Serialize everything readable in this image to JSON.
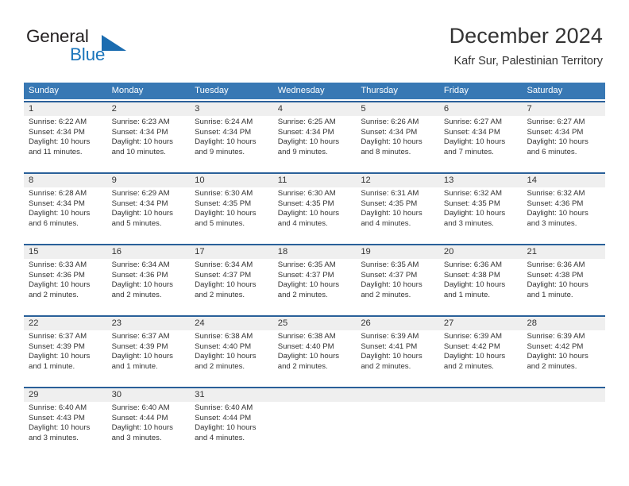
{
  "brand": {
    "name_part1": "General",
    "name_part2": "Blue",
    "triangle_icon": "triangle-icon",
    "accent_color": "#1b75bb"
  },
  "header": {
    "title": "December 2024",
    "subtitle": "Kafr Sur, Palestinian Territory"
  },
  "colors": {
    "header_row_bg": "#3878b4",
    "week_separator": "#2a6099",
    "daynum_bg": "#efefef",
    "text": "#333333"
  },
  "weekdays": [
    "Sunday",
    "Monday",
    "Tuesday",
    "Wednesday",
    "Thursday",
    "Friday",
    "Saturday"
  ],
  "weeks": [
    {
      "days": [
        {
          "num": "1",
          "sunrise": "Sunrise: 6:22 AM",
          "sunset": "Sunset: 4:34 PM",
          "daylight1": "Daylight: 10 hours",
          "daylight2": "and 11 minutes."
        },
        {
          "num": "2",
          "sunrise": "Sunrise: 6:23 AM",
          "sunset": "Sunset: 4:34 PM",
          "daylight1": "Daylight: 10 hours",
          "daylight2": "and 10 minutes."
        },
        {
          "num": "3",
          "sunrise": "Sunrise: 6:24 AM",
          "sunset": "Sunset: 4:34 PM",
          "daylight1": "Daylight: 10 hours",
          "daylight2": "and 9 minutes."
        },
        {
          "num": "4",
          "sunrise": "Sunrise: 6:25 AM",
          "sunset": "Sunset: 4:34 PM",
          "daylight1": "Daylight: 10 hours",
          "daylight2": "and 9 minutes."
        },
        {
          "num": "5",
          "sunrise": "Sunrise: 6:26 AM",
          "sunset": "Sunset: 4:34 PM",
          "daylight1": "Daylight: 10 hours",
          "daylight2": "and 8 minutes."
        },
        {
          "num": "6",
          "sunrise": "Sunrise: 6:27 AM",
          "sunset": "Sunset: 4:34 PM",
          "daylight1": "Daylight: 10 hours",
          "daylight2": "and 7 minutes."
        },
        {
          "num": "7",
          "sunrise": "Sunrise: 6:27 AM",
          "sunset": "Sunset: 4:34 PM",
          "daylight1": "Daylight: 10 hours",
          "daylight2": "and 6 minutes."
        }
      ]
    },
    {
      "days": [
        {
          "num": "8",
          "sunrise": "Sunrise: 6:28 AM",
          "sunset": "Sunset: 4:34 PM",
          "daylight1": "Daylight: 10 hours",
          "daylight2": "and 6 minutes."
        },
        {
          "num": "9",
          "sunrise": "Sunrise: 6:29 AM",
          "sunset": "Sunset: 4:34 PM",
          "daylight1": "Daylight: 10 hours",
          "daylight2": "and 5 minutes."
        },
        {
          "num": "10",
          "sunrise": "Sunrise: 6:30 AM",
          "sunset": "Sunset: 4:35 PM",
          "daylight1": "Daylight: 10 hours",
          "daylight2": "and 5 minutes."
        },
        {
          "num": "11",
          "sunrise": "Sunrise: 6:30 AM",
          "sunset": "Sunset: 4:35 PM",
          "daylight1": "Daylight: 10 hours",
          "daylight2": "and 4 minutes."
        },
        {
          "num": "12",
          "sunrise": "Sunrise: 6:31 AM",
          "sunset": "Sunset: 4:35 PM",
          "daylight1": "Daylight: 10 hours",
          "daylight2": "and 4 minutes."
        },
        {
          "num": "13",
          "sunrise": "Sunrise: 6:32 AM",
          "sunset": "Sunset: 4:35 PM",
          "daylight1": "Daylight: 10 hours",
          "daylight2": "and 3 minutes."
        },
        {
          "num": "14",
          "sunrise": "Sunrise: 6:32 AM",
          "sunset": "Sunset: 4:36 PM",
          "daylight1": "Daylight: 10 hours",
          "daylight2": "and 3 minutes."
        }
      ]
    },
    {
      "days": [
        {
          "num": "15",
          "sunrise": "Sunrise: 6:33 AM",
          "sunset": "Sunset: 4:36 PM",
          "daylight1": "Daylight: 10 hours",
          "daylight2": "and 2 minutes."
        },
        {
          "num": "16",
          "sunrise": "Sunrise: 6:34 AM",
          "sunset": "Sunset: 4:36 PM",
          "daylight1": "Daylight: 10 hours",
          "daylight2": "and 2 minutes."
        },
        {
          "num": "17",
          "sunrise": "Sunrise: 6:34 AM",
          "sunset": "Sunset: 4:37 PM",
          "daylight1": "Daylight: 10 hours",
          "daylight2": "and 2 minutes."
        },
        {
          "num": "18",
          "sunrise": "Sunrise: 6:35 AM",
          "sunset": "Sunset: 4:37 PM",
          "daylight1": "Daylight: 10 hours",
          "daylight2": "and 2 minutes."
        },
        {
          "num": "19",
          "sunrise": "Sunrise: 6:35 AM",
          "sunset": "Sunset: 4:37 PM",
          "daylight1": "Daylight: 10 hours",
          "daylight2": "and 2 minutes."
        },
        {
          "num": "20",
          "sunrise": "Sunrise: 6:36 AM",
          "sunset": "Sunset: 4:38 PM",
          "daylight1": "Daylight: 10 hours",
          "daylight2": "and 1 minute."
        },
        {
          "num": "21",
          "sunrise": "Sunrise: 6:36 AM",
          "sunset": "Sunset: 4:38 PM",
          "daylight1": "Daylight: 10 hours",
          "daylight2": "and 1 minute."
        }
      ]
    },
    {
      "days": [
        {
          "num": "22",
          "sunrise": "Sunrise: 6:37 AM",
          "sunset": "Sunset: 4:39 PM",
          "daylight1": "Daylight: 10 hours",
          "daylight2": "and 1 minute."
        },
        {
          "num": "23",
          "sunrise": "Sunrise: 6:37 AM",
          "sunset": "Sunset: 4:39 PM",
          "daylight1": "Daylight: 10 hours",
          "daylight2": "and 1 minute."
        },
        {
          "num": "24",
          "sunrise": "Sunrise: 6:38 AM",
          "sunset": "Sunset: 4:40 PM",
          "daylight1": "Daylight: 10 hours",
          "daylight2": "and 2 minutes."
        },
        {
          "num": "25",
          "sunrise": "Sunrise: 6:38 AM",
          "sunset": "Sunset: 4:40 PM",
          "daylight1": "Daylight: 10 hours",
          "daylight2": "and 2 minutes."
        },
        {
          "num": "26",
          "sunrise": "Sunrise: 6:39 AM",
          "sunset": "Sunset: 4:41 PM",
          "daylight1": "Daylight: 10 hours",
          "daylight2": "and 2 minutes."
        },
        {
          "num": "27",
          "sunrise": "Sunrise: 6:39 AM",
          "sunset": "Sunset: 4:42 PM",
          "daylight1": "Daylight: 10 hours",
          "daylight2": "and 2 minutes."
        },
        {
          "num": "28",
          "sunrise": "Sunrise: 6:39 AM",
          "sunset": "Sunset: 4:42 PM",
          "daylight1": "Daylight: 10 hours",
          "daylight2": "and 2 minutes."
        }
      ]
    },
    {
      "days": [
        {
          "num": "29",
          "sunrise": "Sunrise: 6:40 AM",
          "sunset": "Sunset: 4:43 PM",
          "daylight1": "Daylight: 10 hours",
          "daylight2": "and 3 minutes."
        },
        {
          "num": "30",
          "sunrise": "Sunrise: 6:40 AM",
          "sunset": "Sunset: 4:44 PM",
          "daylight1": "Daylight: 10 hours",
          "daylight2": "and 3 minutes."
        },
        {
          "num": "31",
          "sunrise": "Sunrise: 6:40 AM",
          "sunset": "Sunset: 4:44 PM",
          "daylight1": "Daylight: 10 hours",
          "daylight2": "and 4 minutes."
        },
        {
          "num": "",
          "sunrise": "",
          "sunset": "",
          "daylight1": "",
          "daylight2": ""
        },
        {
          "num": "",
          "sunrise": "",
          "sunset": "",
          "daylight1": "",
          "daylight2": ""
        },
        {
          "num": "",
          "sunrise": "",
          "sunset": "",
          "daylight1": "",
          "daylight2": ""
        },
        {
          "num": "",
          "sunrise": "",
          "sunset": "",
          "daylight1": "",
          "daylight2": ""
        }
      ]
    }
  ]
}
